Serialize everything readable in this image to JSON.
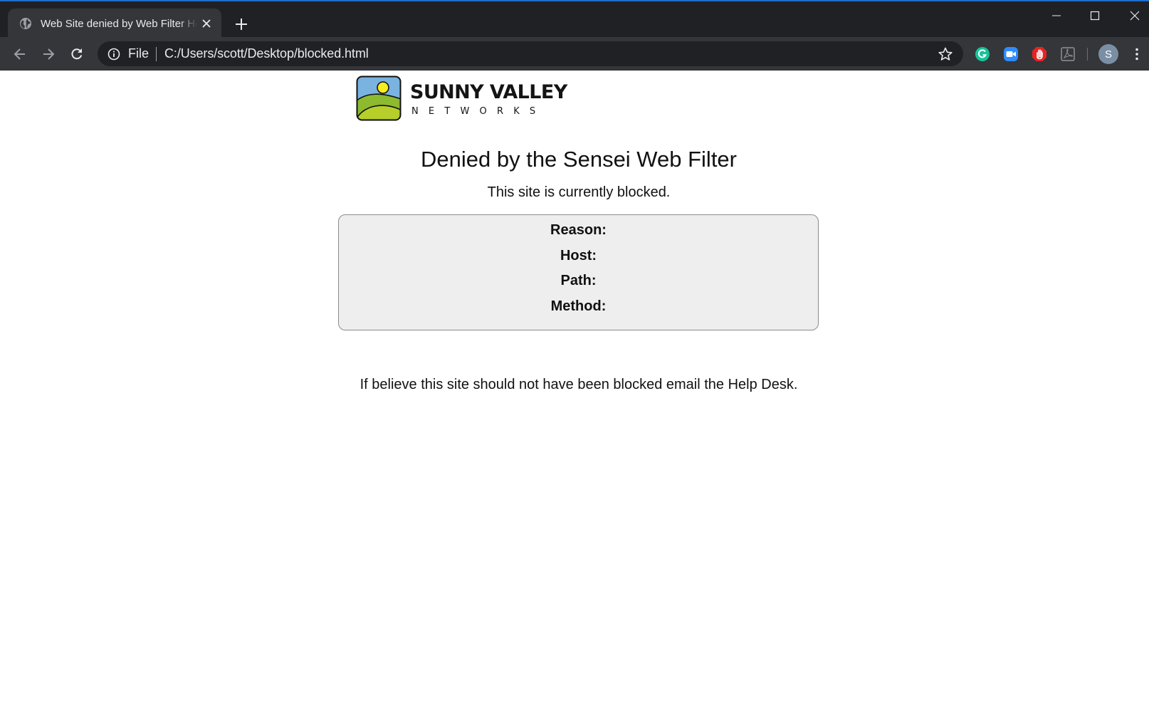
{
  "browser": {
    "tab_title": "Web Site denied by Web Filter Host",
    "address_scheme": "File",
    "address_url": "C:/Users/scott/Desktop/blocked.html",
    "profile_initial": "S",
    "accent_color": "#1e6fd0",
    "extensions": [
      "grammarly-icon",
      "zoom-icon",
      "stop-hand-icon",
      "acrobat-icon"
    ]
  },
  "page": {
    "logo": {
      "name": "SUNNY VALLEY",
      "sub": "NETWORKS"
    },
    "heading": "Denied by the Sensei Web Filter",
    "subheading": "This site is currently blocked.",
    "details": [
      {
        "label": "Reason:",
        "value": ""
      },
      {
        "label": "Host:",
        "value": ""
      },
      {
        "label": "Path:",
        "value": ""
      },
      {
        "label": "Method:",
        "value": ""
      }
    ],
    "help_text": "If believe this site should not have been blocked email the Help Desk."
  }
}
